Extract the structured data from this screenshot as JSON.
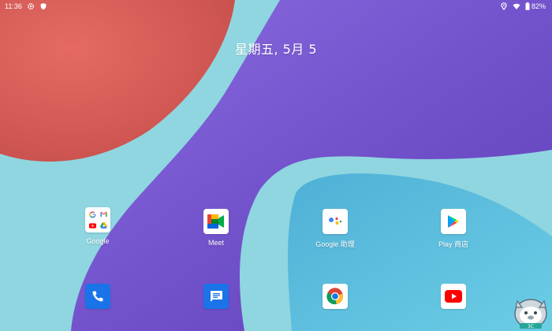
{
  "status_bar": {
    "time": "11:36",
    "left_icons": [
      "settings-icon",
      "shield-icon"
    ],
    "right_icons": [
      "location-icon",
      "wifi-icon",
      "battery-icon"
    ],
    "battery": "82%"
  },
  "date_widget": {
    "text": "星期五, 5月 5"
  },
  "apps_row1": [
    {
      "label": "Google",
      "icon": "google-folder-icon"
    },
    {
      "label": "Meet",
      "icon": "meet-icon"
    },
    {
      "label": "Google 助理",
      "icon": "assistant-icon"
    },
    {
      "label": "Play 商店",
      "icon": "play-store-icon"
    }
  ],
  "dock": [
    {
      "icon": "phone-icon"
    },
    {
      "icon": "messages-icon"
    },
    {
      "icon": "chrome-icon"
    },
    {
      "icon": "youtube-icon"
    }
  ],
  "colors": {
    "wallpaper_cyan": "#8fd6e0",
    "wallpaper_red": "#e06660",
    "wallpaper_purple": "#7a5ad0",
    "wallpaper_blue": "#5ab8d8"
  },
  "watermark": {
    "text": "3C"
  }
}
